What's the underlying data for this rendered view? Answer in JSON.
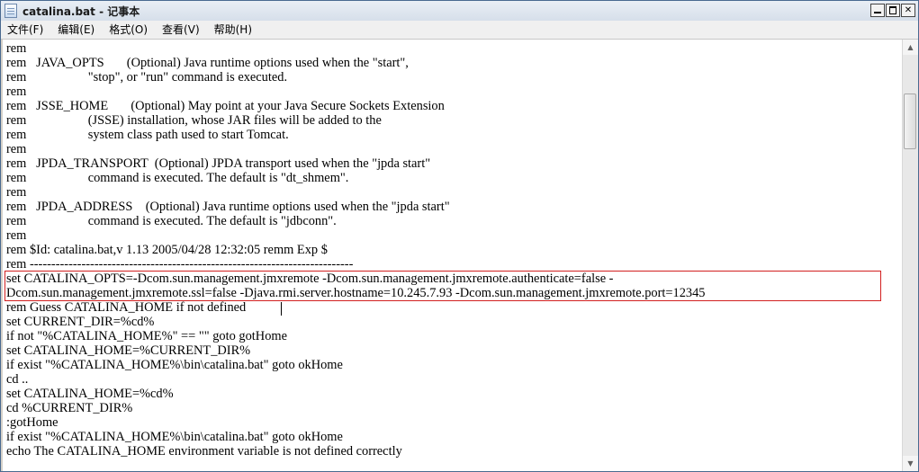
{
  "window": {
    "title": "catalina.bat - 记事本"
  },
  "icons": {
    "app": "notepad-icon",
    "minimize": "minimize-icon",
    "maximize": "maximize-icon",
    "close": "close-icon",
    "scroll_up": "scroll-up-arrow-icon",
    "scroll_down": "scroll-down-arrow-icon"
  },
  "titlebar_buttons": {
    "close_glyph": "✕"
  },
  "menu": [
    {
      "label": "文件(F)"
    },
    {
      "label": "编辑(E)"
    },
    {
      "label": "格式(O)"
    },
    {
      "label": "查看(V)"
    },
    {
      "label": "帮助(H)"
    }
  ],
  "scroll_glyphs": {
    "up": "▲",
    "down": "▼"
  },
  "editor": {
    "lines": [
      "rem",
      "rem   JAVA_OPTS       (Optional) Java runtime options used when the \"start\",",
      "rem                   \"stop\", or \"run\" command is executed.",
      "rem",
      "rem   JSSE_HOME       (Optional) May point at your Java Secure Sockets Extension",
      "rem                   (JSSE) installation, whose JAR files will be added to the",
      "rem                   system class path used to start Tomcat.",
      "rem",
      "rem   JPDA_TRANSPORT  (Optional) JPDA transport used when the \"jpda start\"",
      "rem                   command is executed. The default is \"dt_shmem\".",
      "rem",
      "rem   JPDA_ADDRESS    (Optional) Java runtime options used when the \"jpda start\"",
      "rem                   command is executed. The default is \"jdbconn\".",
      "rem",
      "rem $Id: catalina.bat,v 1.13 2005/04/28 12:32:05 remm Exp $",
      "rem ---------------------------------------------------------------------------",
      "set CATALINA_OPTS=-Dcom.sun.management.jmxremote -Dcom.sun.management.jmxremote.authenticate=false -",
      "Dcom.sun.management.jmxremote.ssl=false -Djava.rmi.server.hostname=10.245.7.93 -Dcom.sun.management.jmxremote.port=12345",
      "rem Guess CATALINA_HOME if not defined",
      "set CURRENT_DIR=%cd%",
      "if not \"%CATALINA_HOME%\" == \"\" goto gotHome",
      "set CATALINA_HOME=%CURRENT_DIR%",
      "if exist \"%CATALINA_HOME%\\bin\\catalina.bat\" goto okHome",
      "cd ..",
      "set CATALINA_HOME=%cd%",
      "cd %CURRENT_DIR%",
      ":gotHome",
      "if exist \"%CATALINA_HOME%\\bin\\catalina.bat\" goto okHome",
      "echo The CATALINA_HOME environment variable is not defined correctly"
    ]
  },
  "colors": {
    "highlight_border": "#d22020"
  }
}
